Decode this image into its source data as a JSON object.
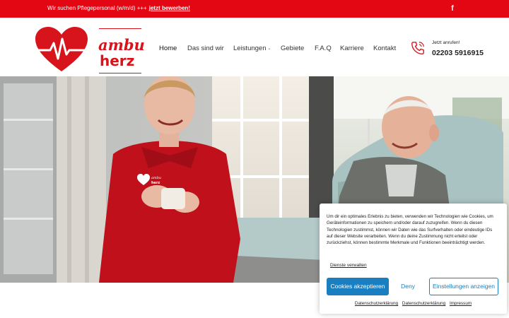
{
  "topbar": {
    "message": "Wir suchen Pflegepersonal (w/m/d) +++",
    "link": "jetzt bewerben!",
    "facebook_glyph": "f"
  },
  "logo": {
    "line1": "ambu",
    "line2": "herz"
  },
  "nav": {
    "items": [
      {
        "label": "Home",
        "active": true
      },
      {
        "label": "Das sind wir"
      },
      {
        "label": "Leistungen",
        "caret": "⌄"
      },
      {
        "label": "Gebiete"
      },
      {
        "label": "F.A.Q"
      },
      {
        "label": "Karriere"
      },
      {
        "label": "Kontakt"
      }
    ]
  },
  "call": {
    "label": "Jetzt anrufen!",
    "number": "02203 5916915",
    "icon": "phone-icon"
  },
  "hero": {
    "badge_line1": "ambu",
    "badge_line2": "herz"
  },
  "cookie": {
    "text": "Um dir ein optimales Erlebnis zu bieten, verwenden wir Technologien wie Cookies, um Geräteinformationen zu speichern und/oder darauf zuzugreifen. Wenn du diesen Technologien zustimmst, können wir Daten wie das Surfverhalten oder eindeutige IDs auf dieser Website verarbeiten. Wenn du deine Zustimmung nicht erteilst oder zurückziehst, können bestimmte Merkmale und Funktionen beeinträchtigt werden.",
    "manage": "Dienste verwalten",
    "accept": "Cookies akzeptieren",
    "deny": "Deny",
    "settings": "Einstellungen anzeigen",
    "links": [
      "Datenschutzerklärung",
      "Datenschutzerklärung",
      "Impressum"
    ]
  },
  "colors": {
    "brand_red": "#e30613",
    "cookie_blue": "#1a7fc1"
  }
}
